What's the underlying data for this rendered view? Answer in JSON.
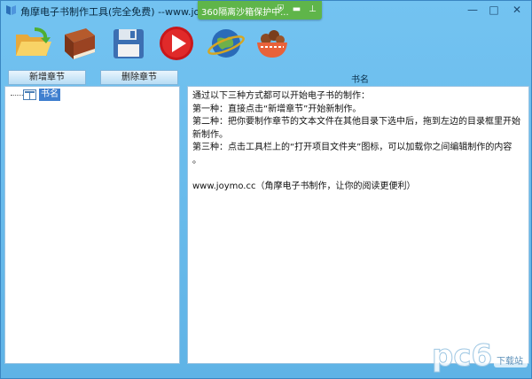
{
  "window": {
    "title": "角摩电子书制作工具(完全免费) --www.joymo.cc",
    "sandbox_notice": "360隔离沙箱保护中...",
    "minimize": "—",
    "maximize": "□",
    "close": "✕"
  },
  "toolbar": {
    "items": [
      {
        "name": "open-project-folder",
        "icon": "folder-open-icon"
      },
      {
        "name": "book",
        "icon": "book-icon"
      },
      {
        "name": "save",
        "icon": "floppy-disk-icon"
      },
      {
        "name": "play",
        "icon": "play-icon"
      },
      {
        "name": "website",
        "icon": "globe-icon"
      },
      {
        "name": "donate",
        "icon": "bowl-icon"
      }
    ]
  },
  "chapters": {
    "add_label": "新增章节",
    "delete_label": "删除章节",
    "tree": [
      {
        "label": "书名",
        "selected": true
      }
    ]
  },
  "content": {
    "title": "书名",
    "lines": [
      "通过以下三种方式都可以开始电子书的制作：",
      "第一种：直接点击“新增章节”开始新制作。",
      "第二种：把你要制作章节的文本文件在其他目录下选中后，拖到左边的目录框里开始",
      "新制作。",
      "第三种：点击工具栏上的“打开项目文件夹”图标，可以加载你之间编辑制作的内容",
      "。",
      "",
      "www.joymo.cc（角摩电子书制作，让你的阅读更便利）"
    ]
  },
  "watermark": {
    "text": "pc6",
    "sub": "下载站"
  },
  "colors": {
    "accent": "#5fb3e6",
    "sandbox": "#5fb54a",
    "selection": "#3f7fcf"
  }
}
